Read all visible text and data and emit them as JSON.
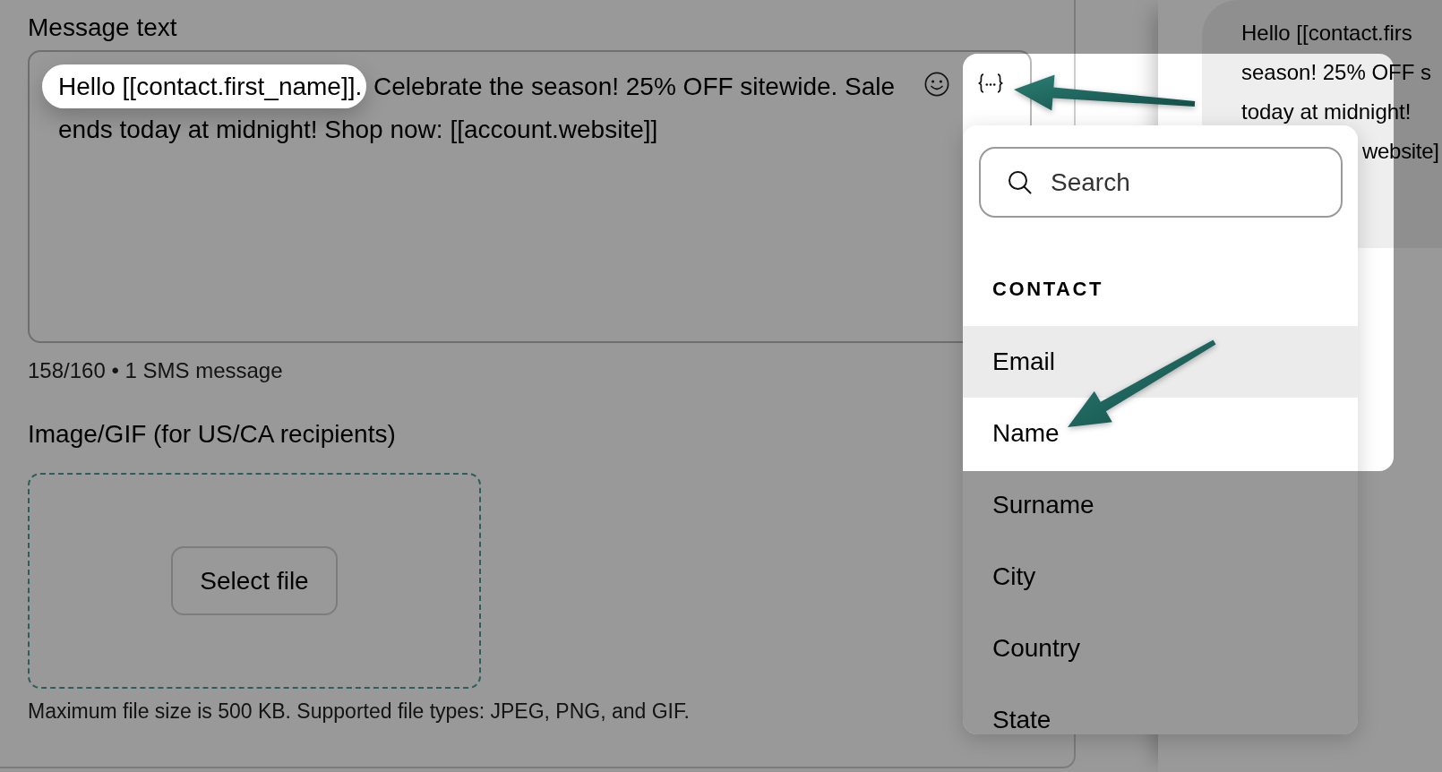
{
  "message_field": {
    "label": "Message text",
    "value_parts": [
      {
        "text": "Hello [[contact.first_name]].",
        "highlighted": true
      },
      {
        "text": "Celebrate the season! 25% OFF sitewide. Sale ends today at midnight! Shop now: [[account.website]]",
        "highlighted": false
      }
    ],
    "counter": "158/160 • 1 SMS message"
  },
  "image_upload": {
    "label": "Image/GIF (for US/CA recipients)",
    "button": "Select file",
    "hint": "Maximum file size is 500 KB. Supported file types: JPEG, PNG, and GIF."
  },
  "preview": {
    "lines": [
      "Hello [[contact.firs",
      "season! 25% OFF s",
      "today at midnight!",
      "website]"
    ]
  },
  "variable_menu": {
    "search": {
      "placeholder": "Search"
    },
    "section": "CONTACT",
    "items": [
      {
        "label": "Email",
        "selected": true
      },
      {
        "label": "Name",
        "selected": false
      },
      {
        "label": "Surname",
        "selected": false
      },
      {
        "label": "City",
        "selected": false
      },
      {
        "label": "Country",
        "selected": false
      },
      {
        "label": "State",
        "selected": false
      }
    ]
  }
}
